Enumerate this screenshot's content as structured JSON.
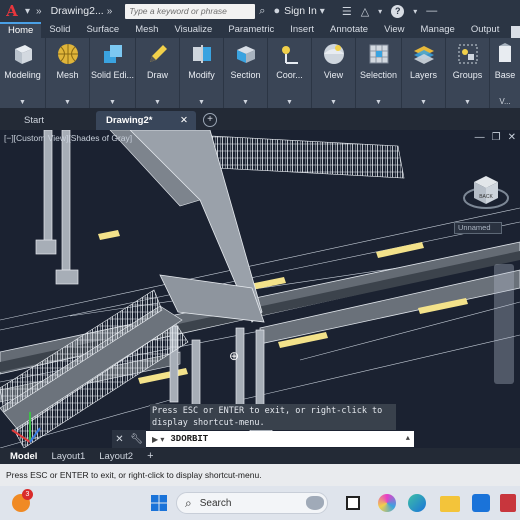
{
  "titlebar": {
    "app_logo": "A",
    "doc_title": "Drawing2...",
    "search_placeholder": "Type a keyword or phrase",
    "sign_in": "Sign In",
    "help": "?"
  },
  "ribbon_tabs": [
    "Home",
    "Solid",
    "Surface",
    "Mesh",
    "Visualize",
    "Parametric",
    "Insert",
    "Annotate",
    "View",
    "Manage",
    "Output"
  ],
  "ribbon_buttons": [
    {
      "label": "Modeling",
      "icon": "box-icon"
    },
    {
      "label": "Mesh",
      "icon": "sphere-icon"
    },
    {
      "label": "Solid Edi...",
      "icon": "solid-edit-icon"
    },
    {
      "label": "Draw",
      "icon": "pencil-icon"
    },
    {
      "label": "Modify",
      "icon": "modify-icon"
    },
    {
      "label": "Section",
      "icon": "section-icon"
    },
    {
      "label": "Coor...",
      "icon": "ucs-icon"
    },
    {
      "label": "View",
      "icon": "view-icon"
    },
    {
      "label": "Selection",
      "icon": "selection-icon"
    },
    {
      "label": "Layers",
      "icon": "layers-icon"
    },
    {
      "label": "Groups",
      "icon": "groups-icon"
    },
    {
      "label": "Base",
      "icon": "base-icon"
    }
  ],
  "ribbon_extra": "V...",
  "file_tabs": {
    "start": "Start",
    "active": "Drawing2*",
    "close": "✕"
  },
  "viewport": {
    "label": "[−][Custom View][Shades of Gray]",
    "viewcube_face": "BACK",
    "ucs_label": "Unnamed",
    "tooltip_line1": "Press ESC or ENTER to exit, or right-click to",
    "tooltip_line2": "display shortcut-menu."
  },
  "command": {
    "value": "3DORBIT"
  },
  "layout_tabs": [
    "Model",
    "Layout1",
    "Layout2"
  ],
  "status_text": "Press ESC or ENTER to exit, or right-click to display shortcut-menu.",
  "taskbar": {
    "search_label": "Search",
    "notification_count": "3"
  },
  "colors": {
    "accent": "#4aa0e6",
    "logo": "#e8363d",
    "road_marking": "#f3e28a"
  }
}
